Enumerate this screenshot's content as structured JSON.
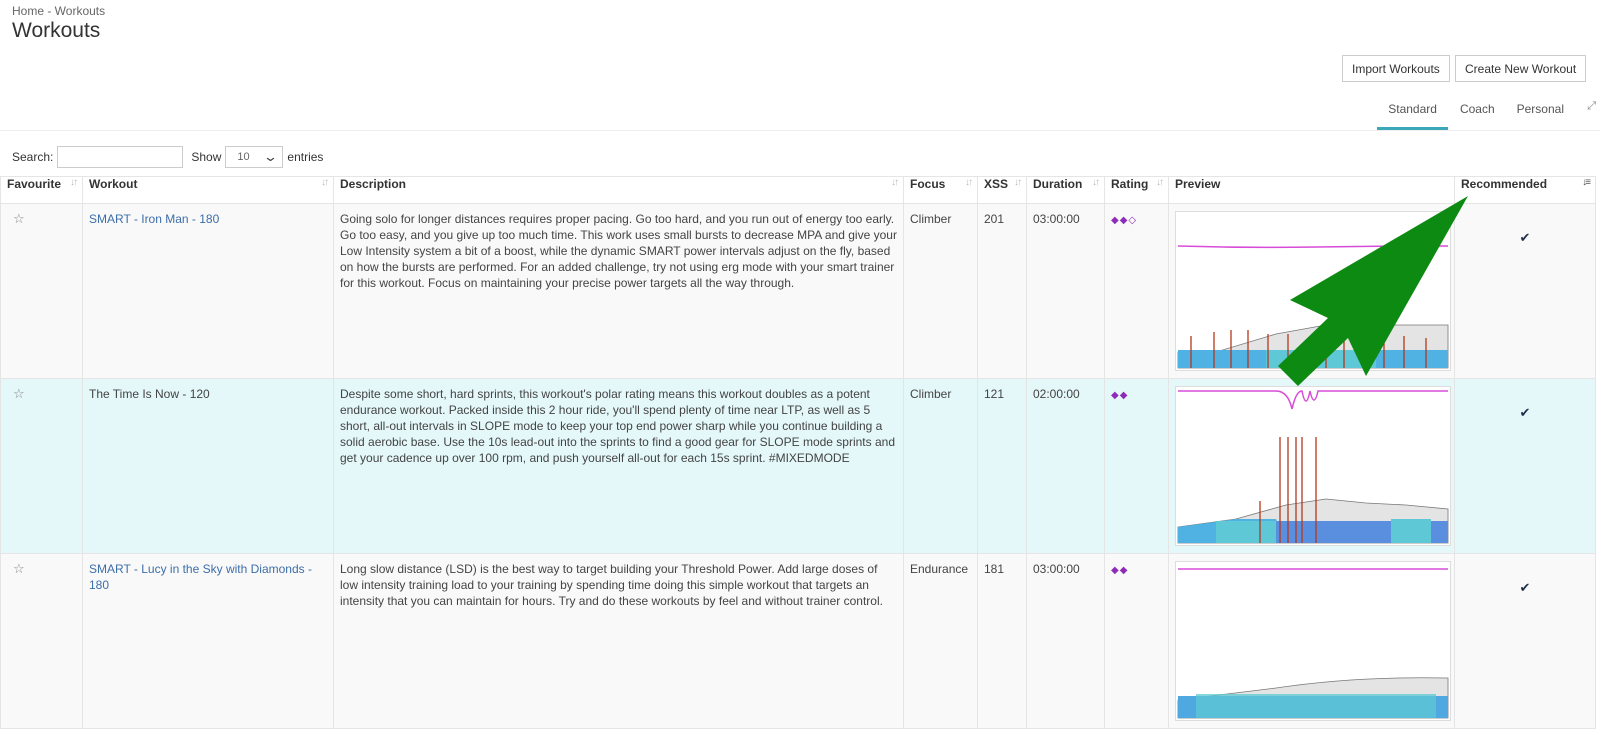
{
  "breadcrumb": "Home - Workouts",
  "title": "Workouts",
  "actions": {
    "import": "Import Workouts",
    "create": "Create New Workout"
  },
  "tabs": [
    "Standard",
    "Coach",
    "Personal"
  ],
  "controls": {
    "search_label": "Search:",
    "show_label": "Show",
    "entries_value": "10",
    "entries_label": "entries"
  },
  "columns": [
    "Favourite",
    "Workout",
    "Description",
    "Focus",
    "XSS",
    "Duration",
    "Rating",
    "Preview",
    "Recommended"
  ],
  "rows": [
    {
      "workout": "SMART - Iron Man - 180",
      "description": "Going solo for longer distances requires proper pacing. Go too hard, and you run out of energy too early. Go too easy, and you give up too much time. This work uses small bursts to decrease MPA and give your Low Intensity system a bit of a boost, while the dynamic SMART power intervals adjust on the fly, based on how the bursts are performed. For an added challenge, try not using erg mode with your smart trainer for this workout. Focus on maintaining your precise power targets all the way through.",
      "focus": "Climber",
      "xss": "201",
      "duration": "03:00:00",
      "rating": "◆◆◇"
    },
    {
      "workout": "The Time Is Now - 120",
      "description": "Despite some short, hard sprints, this workout's polar rating means this workout doubles as a potent endurance workout. Packed inside this 2 hour ride, you'll spend plenty of time near LTP, as well as 5 short, all-out intervals in SLOPE mode to keep your top end power sharp while you continue building a solid aerobic base. Use the 10s lead-out into the sprints to find a good gear for SLOPE mode sprints and get your cadence up over 100 rpm, and push yourself all-out for each 15s sprint. #MIXEDMODE",
      "focus": "Climber",
      "xss": "121",
      "duration": "02:00:00",
      "rating": "◆◆"
    },
    {
      "workout": "SMART - Lucy in the Sky with Diamonds - 180",
      "description": "Long slow distance (LSD) is the best way to target building your Threshold Power. Add large doses of low intensity training load to your training by spending time doing this simple workout that targets an intensity that you can maintain for hours. Try and do these workouts by feel and without trainer control.",
      "focus": "Endurance",
      "xss": "181",
      "duration": "03:00:00",
      "rating": "◆◆"
    }
  ],
  "colors": {
    "accent": "#3aa8b8",
    "link": "#3d6ea8",
    "rating": "#8e2bb8",
    "arrow": "#0d8a12"
  }
}
